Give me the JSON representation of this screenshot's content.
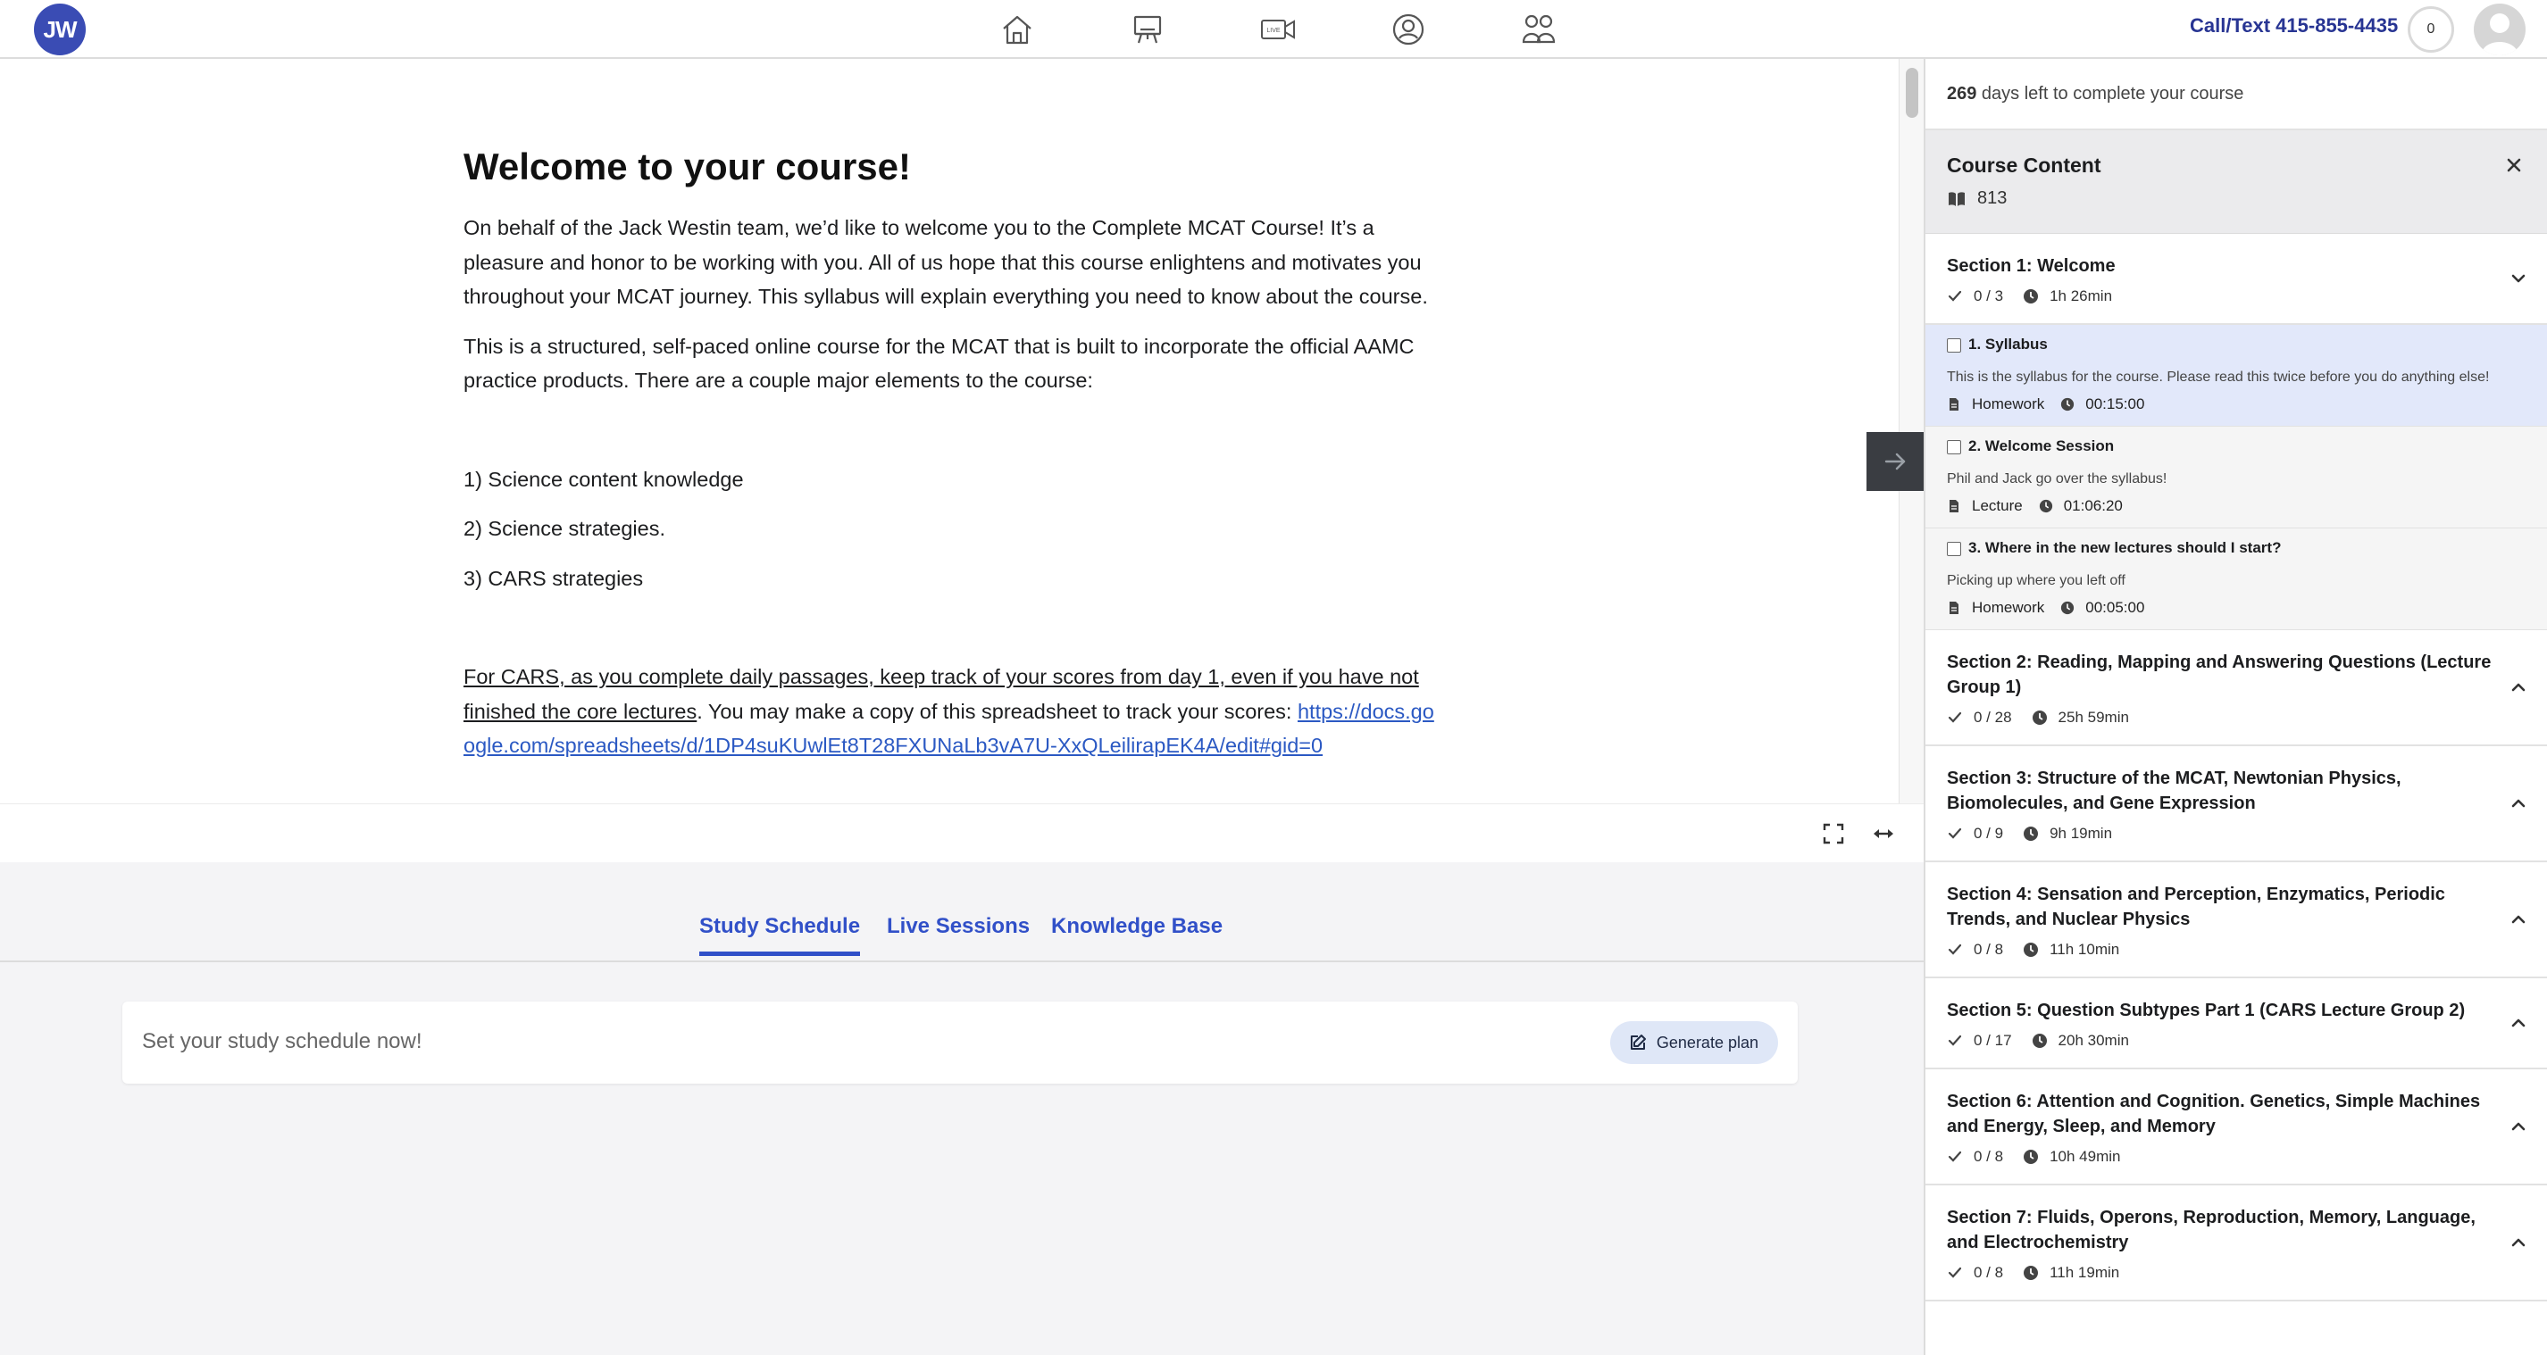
{
  "brand": {
    "logo_text": "JW",
    "accent": "#3150c8",
    "logo_color": "#3a4cb4"
  },
  "nav": {
    "icons": [
      "home-icon",
      "classroom-icon",
      "live-video-icon",
      "profile-icon",
      "community-icon"
    ],
    "live_label": "LIVE",
    "contact": "Call/Text 415-855-4435",
    "coins": "0"
  },
  "article": {
    "title": "Welcome to your course!",
    "p1": "On behalf of the Jack Westin team, we’d like to welcome you to the Complete MCAT Course! It’s a pleasure and honor to be working with you. All of us hope that this course enlightens and motivates you throughout your MCAT journey. This syllabus will explain everything you need to know about the course.",
    "p2": "This is a structured, self-paced online course for the MCAT that is built to incorporate the official AAMC practice products. There are a couple major elements to the course:",
    "item1": "1) Science content knowledge",
    "item2": "2) Science strategies.",
    "item3": "3) CARS strategies",
    "p3_underlined": "For CARS, as you complete daily passages, keep track of your scores from day 1, even if you have not finished the core lectures",
    "p3_rest": ". You may make a copy of this spreadsheet to track your scores: ",
    "p3_link": "https://docs.google.com/spreadsheets/d/1DP4suKUwlEt8T28FXUNaLb3vA7U-XxQLeilirapEK4A/edit#gid=0"
  },
  "tabs": {
    "study_schedule": "Study Schedule",
    "live_sessions": "Live Sessions",
    "knowledge_base": "Knowledge Base"
  },
  "schedule": {
    "prompt": "Set your study schedule now!",
    "button": "Generate plan"
  },
  "sidebar": {
    "days_count": "269",
    "days_text": " days left to complete your course",
    "title": "Course Content",
    "count": "813",
    "section1": {
      "title": "Section 1: Welcome",
      "progress": "0 / 3",
      "duration": "1h 26min",
      "lessons": [
        {
          "title": "1. Syllabus",
          "desc": "This is the syllabus for the course. Please read this twice before you do anything else!",
          "type": "Homework",
          "time": "00:15:00"
        },
        {
          "title": "2. Welcome Session",
          "desc": "Phil and Jack go over the syllabus!",
          "type": "Lecture",
          "time": "01:06:20"
        },
        {
          "title": "3. Where in the new lectures should I start?",
          "desc": "Picking up where you left off",
          "type": "Homework",
          "time": "00:05:00"
        }
      ]
    },
    "sections": [
      {
        "title": "Section 2: Reading, Mapping and Answering Questions (Lecture Group 1)",
        "progress": "0 / 28",
        "duration": "25h 59min"
      },
      {
        "title": "Section 3: Structure of the MCAT, Newtonian Physics, Biomolecules, and Gene Expression",
        "progress": "0 / 9",
        "duration": "9h 19min"
      },
      {
        "title": "Section 4: Sensation and Perception, Enzymatics, Periodic Trends, and Nuclear Physics",
        "progress": "0 / 8",
        "duration": "11h 10min"
      },
      {
        "title": "Section 5: Question Subtypes Part 1 (CARS Lecture Group 2)",
        "progress": "0 / 17",
        "duration": "20h 30min"
      },
      {
        "title": "Section 6: Attention and Cognition. Genetics, Simple Machines and Energy, Sleep, and Memory",
        "progress": "0 / 8",
        "duration": "10h 49min"
      },
      {
        "title": "Section 7: Fluids, Operons, Reproduction, Memory, Language, and Electrochemistry",
        "progress": "0 / 8",
        "duration": "11h 19min"
      }
    ]
  }
}
